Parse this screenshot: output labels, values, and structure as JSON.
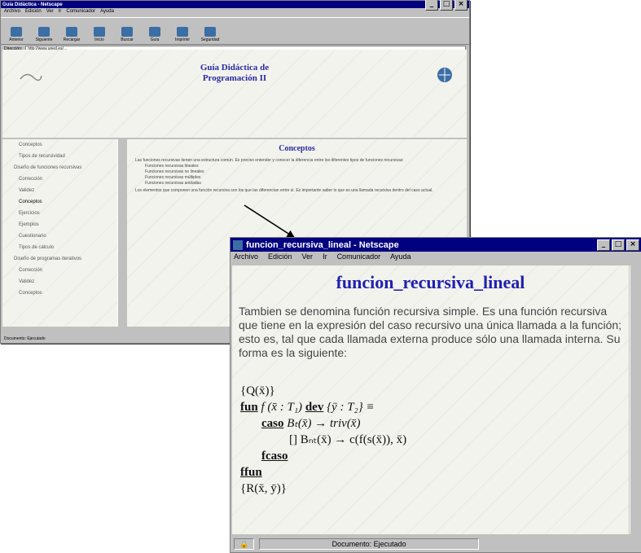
{
  "back_window": {
    "title": "Guía Didáctica - Netscape",
    "menu": [
      "Archivo",
      "Edición",
      "Ver",
      "Ir",
      "Comunicador",
      "Ayuda"
    ],
    "toolbar": [
      "Anterior",
      "Siguiente",
      "Recargar",
      "Inicio",
      "Buscar",
      "Guía",
      "Imprimir",
      "Seguridad"
    ],
    "address_label": "Dirección:",
    "address_url": "http://www.uned.es/...",
    "header_title": "Guía Didáctica de Programación II",
    "nav": [
      {
        "label": "Conceptos",
        "sub": true
      },
      {
        "label": "Tipos de recursividad",
        "sub": true
      },
      {
        "label": "Diseño de funciones recursivas",
        "sub": false
      },
      {
        "label": "Corrección",
        "sub": true
      },
      {
        "label": "Validez",
        "sub": true
      },
      {
        "label": "Conceptos",
        "sub": true
      },
      {
        "label": "Ejercicios",
        "sub": true
      },
      {
        "label": "Ejemplos",
        "sub": true
      },
      {
        "label": "Cuestionario",
        "sub": true
      },
      {
        "label": "Tipos de cálculo",
        "sub": true
      },
      {
        "label": "Diseño de programas iterativos",
        "sub": false
      },
      {
        "label": "Corrección",
        "sub": true
      },
      {
        "label": "Validez",
        "sub": true
      },
      {
        "label": "Conceptos",
        "sub": true
      }
    ],
    "section_title": "Conceptos",
    "paragraph": "Las funciones recursivas tienen una estructura común. Es preciso entender y conocer la diferencia entre los diferentes tipos de funciones recursivas:",
    "bullets": [
      "Funciones recursivas lineales",
      "Funciones recursivas no lineales",
      "Funciones recursivas múltiples",
      "Funciones recursivas anidadas"
    ],
    "paragraph2": "Los elementos que componen una función recursiva son los que las diferencian entre sí. Es importante saber lo que es una llamada recursiva dentro del caso actual.",
    "status": "Documento: Ejecutado"
  },
  "front_window": {
    "title": "funcion_recursiva_lineal - Netscape",
    "menu": [
      "Archivo",
      "Edición",
      "Ver",
      "Ir",
      "Comunicador",
      "Ayuda"
    ],
    "heading": "funcion_recursiva_lineal",
    "paragraph": "Tambien se denomina función recursiva simple. Es una función recursiva que tiene en la expresión del caso recursivo una única llamada a la función; esto es, tal que cada llamada externa produce sólo una llamada interna. Su forma es la siguiente:",
    "code": {
      "pre": "{Q(x̄)}",
      "fun_kw": "fun",
      "fun_sig": " f (x̄ : T₁) ",
      "dev_kw": "dev",
      "dev_sig": " {ȳ : T₂} ≡",
      "caso_kw": "caso",
      "caso_line": " Bₜ(x̄) → triv(x̄)",
      "nt_line": "[]  Bₙₜ(x̄) → c(f(s(x̄)), x̄)",
      "fcaso_kw": "fcaso",
      "ffun_kw": "ffun",
      "post": "{R(x̄, ȳ)}"
    },
    "status": "Documento: Ejecutado"
  },
  "colors": {
    "title_blue": "#2020b0",
    "titlebar": "#000080",
    "chrome": "#c0c0c0"
  }
}
